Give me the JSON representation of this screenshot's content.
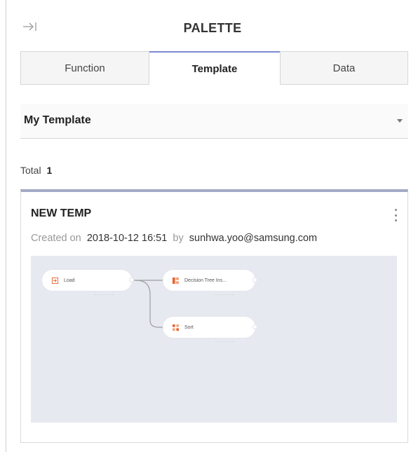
{
  "header": {
    "title": "PALETTE",
    "collapse_icon": "collapse-arrow-icon"
  },
  "tabs": [
    {
      "label": "Function",
      "active": false
    },
    {
      "label": "Template",
      "active": true
    },
    {
      "label": "Data",
      "active": false
    }
  ],
  "template_select": {
    "value": "My Template"
  },
  "total": {
    "label": "Total",
    "count": "1"
  },
  "card": {
    "title": "NEW TEMP",
    "created_label": "Created on",
    "created_date": "2018-10-12 16:51",
    "by_label": "by",
    "author": "sunhwa.yoo@samsung.com",
    "flow": {
      "nodes": [
        {
          "label": "Load",
          "icon": "load-icon",
          "sub": "- - - - - - -"
        },
        {
          "label": "Decision Tree Ins...",
          "icon": "decision-tree-icon",
          "sub": "- - - - - - -"
        },
        {
          "label": "Sort",
          "icon": "sort-icon",
          "sub": "- - - - - - -"
        }
      ]
    }
  },
  "colors": {
    "tab_active_accent": "#7c8bd1",
    "card_accent": "#a3aac4",
    "preview_bg": "#e6e9f0",
    "node_icon": "#e8622b"
  }
}
